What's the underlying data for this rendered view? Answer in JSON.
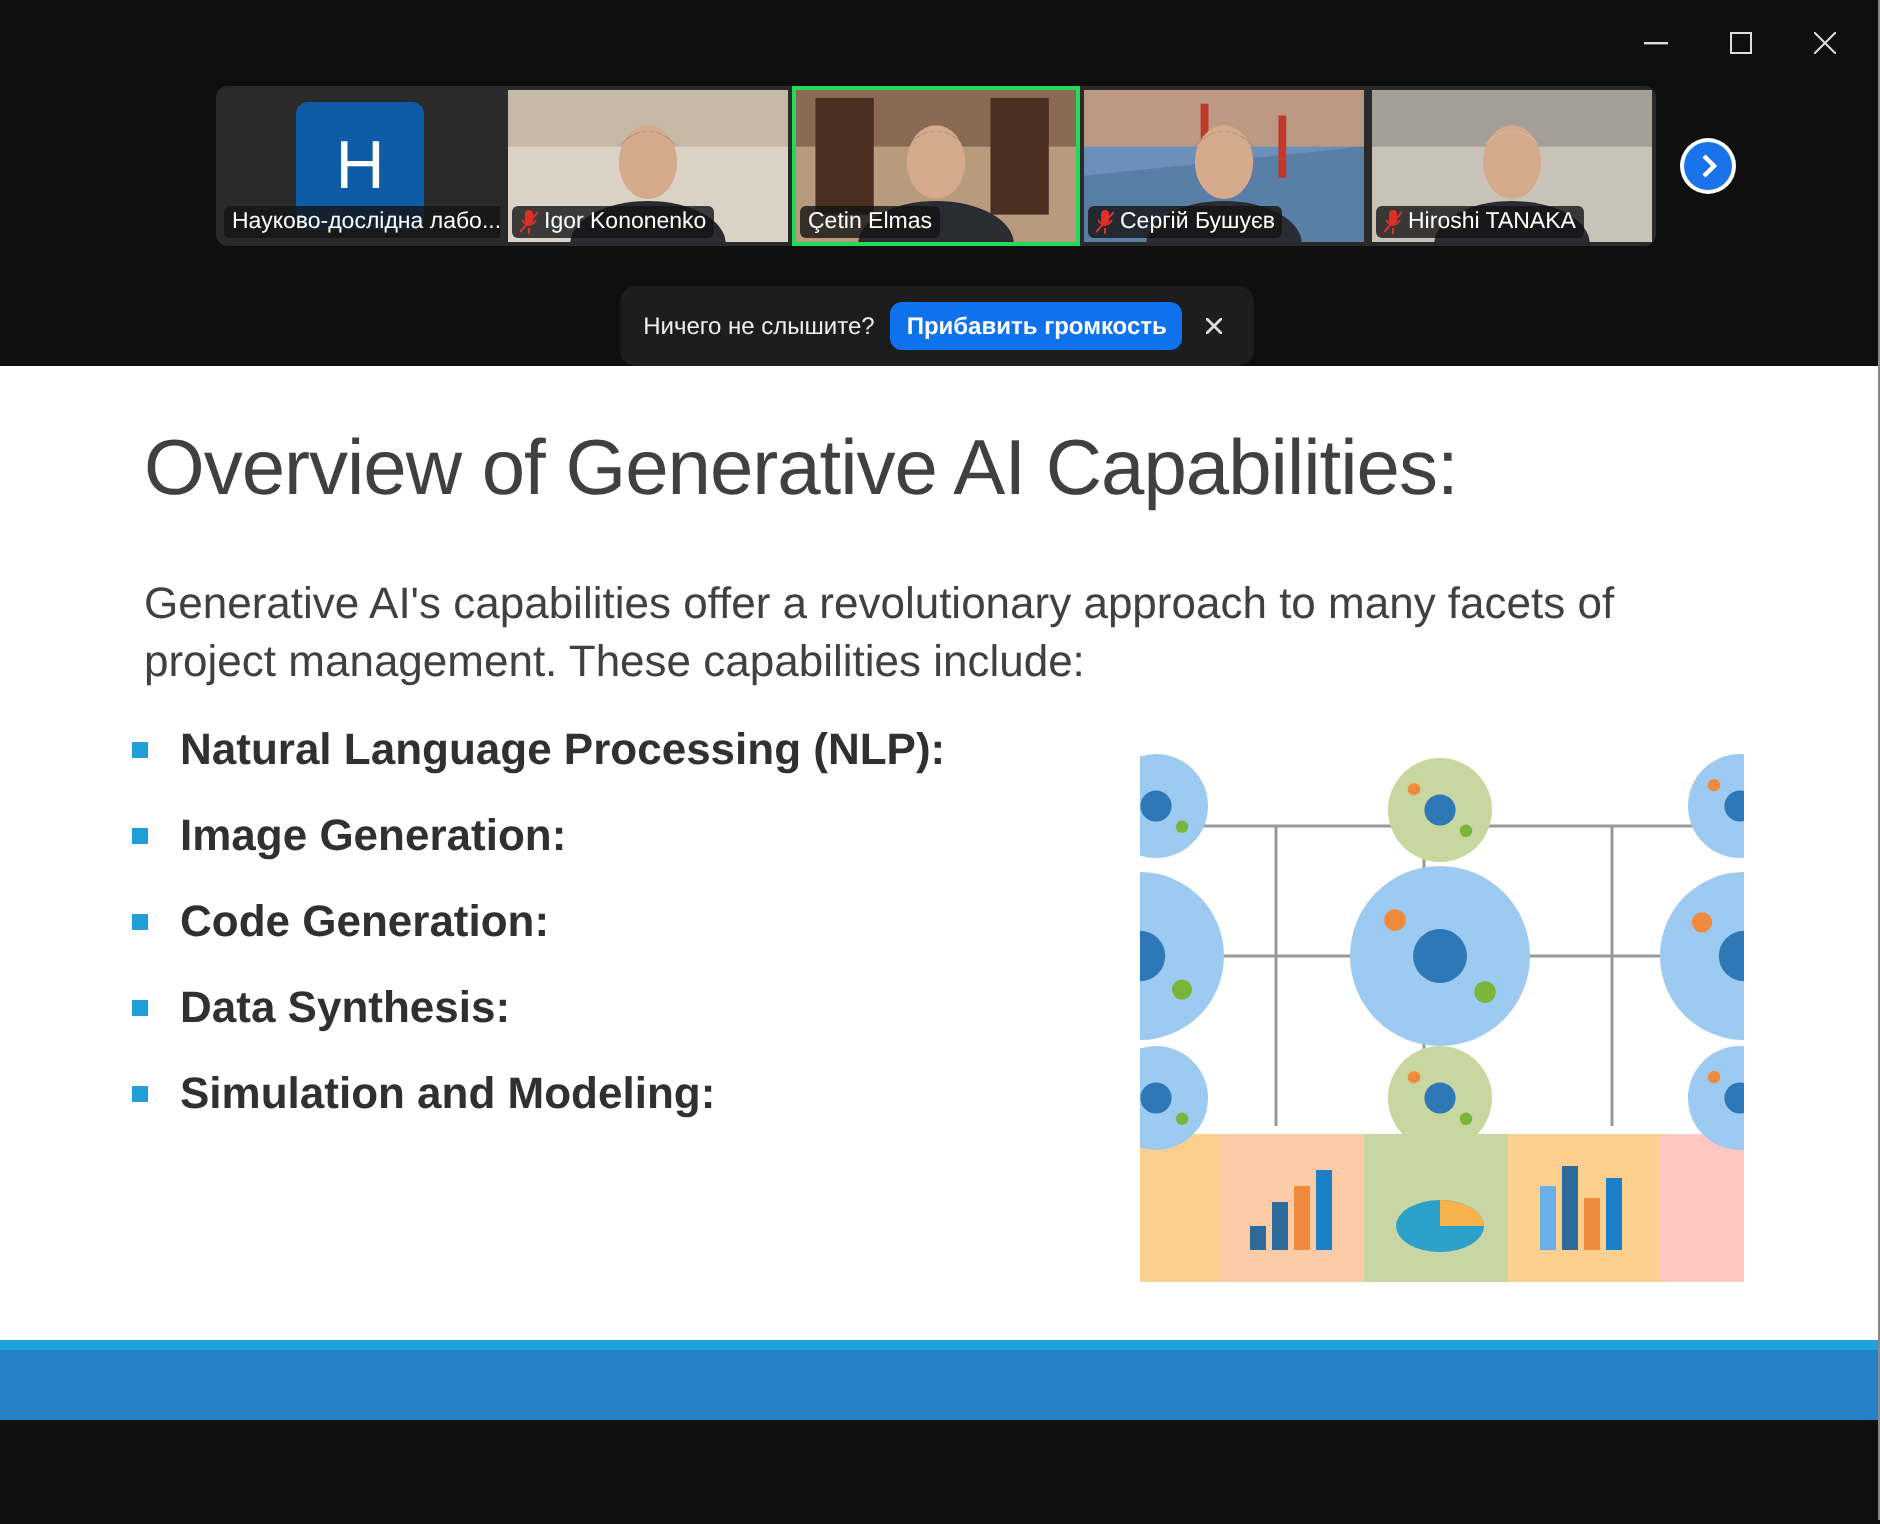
{
  "participants": [
    {
      "kind": "avatar",
      "initial": "H",
      "name": "Науково-дослідна лабо...",
      "muted": false,
      "selected": false
    },
    {
      "kind": "video",
      "name": "Igor Kononenko",
      "muted": true,
      "selected": false
    },
    {
      "kind": "video",
      "name": "Çetin Elmas",
      "muted": false,
      "selected": true
    },
    {
      "kind": "video",
      "name": "Сергій Бушуєв",
      "muted": true,
      "selected": false
    },
    {
      "kind": "video",
      "name": "Hiroshi TANAKA",
      "muted": true,
      "selected": false
    }
  ],
  "notice": {
    "text": "Ничего не слышите?",
    "button": "Прибавить громкость"
  },
  "slide": {
    "title": "Overview of Generative AI Capabilities:",
    "intro": "Generative AI's capabilities offer a revolutionary approach to many facets of project management. These capabilities include:",
    "bullets": [
      "Natural Language Processing (NLP):",
      "Image Generation:",
      "Code Generation:",
      "Data Synthesis:",
      "Simulation and Modeling:"
    ]
  }
}
